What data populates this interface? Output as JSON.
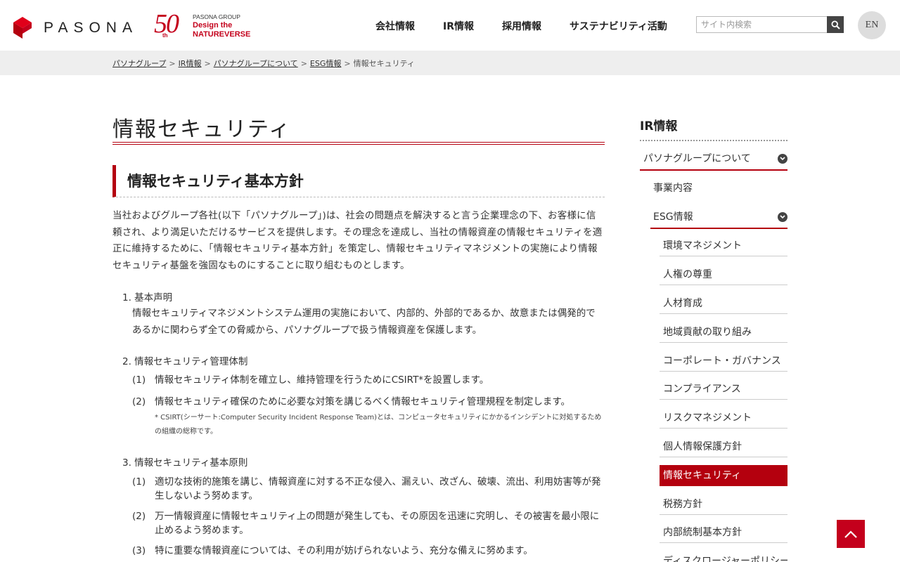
{
  "header": {
    "logo_text": "PASONA",
    "anniversary": {
      "number": "50",
      "suffix": "th",
      "group": "PASONA GROUP",
      "line1": "Design the",
      "line2": "NATUREVERSE"
    },
    "nav": [
      "会社情報",
      "IR情報",
      "採用情報",
      "サステナビリティ活動"
    ],
    "search_placeholder": "サイト内検索",
    "lang_button": "EN"
  },
  "breadcrumb": {
    "links": [
      "パソナグループ",
      "IR情報",
      "パソナグループについて",
      "ESG情報"
    ],
    "current": "情報セキュリティ",
    "separator": ">"
  },
  "main": {
    "page_title": "情報セキュリティ",
    "section_heading": "情報セキュリティ基本方針",
    "intro": "当社およびグループ各社(以下「パソナグループ」)は、社会の問題点を解決すると言う企業理念の下、お客様に信頼され、より満足いただけるサービスを提供します。その理念を達成し、当社の情報資産の情報セキュリティを適正に維持するために、「情報セキュリティ基本方針」を策定し、情報セキュリティマネジメントの実施により情報セキュリティ基盤を強固なものにすることに取り組むものとします。",
    "sections": [
      {
        "title": "1. 基本声明",
        "body": "情報セキュリティマネジメントシステム運用の実施において、内部的、外部的であるか、故意または偶発的であるかに関わらず全ての脅威から、パソナグループで扱う情報資産を保護します。"
      },
      {
        "title": "2. 情報セキュリティ管理体制",
        "items": [
          {
            "no": "(1)",
            "text": "情報セキュリティ体制を確立し、維持管理を行うためにCSIRT*を設置します。"
          },
          {
            "no": "(2)",
            "text": "情報セキュリティ確保のために必要な対策を講じるべく情報セキュリティ管理規程を制定します。"
          }
        ],
        "note": "* CSIRT(シーサート:Computer Security Incident Response Team)とは、コンピュータセキュリティにかかるインシデントに対処するための組織の総称です。"
      },
      {
        "title": "3. 情報セキュリティ基本原則",
        "items": [
          {
            "no": "(1)",
            "text": "適切な技術的施策を講じ、情報資産に対する不正な侵入、漏えい、改ざん、破壊、流出、利用妨害等が発生しないよう努めます。"
          },
          {
            "no": "(2)",
            "text": "万一情報資産に情報セキュリティ上の問題が発生しても、その原因を迅速に究明し、その被害を最小限に止めるよう努めます。"
          },
          {
            "no": "(3)",
            "text": "特に重要な情報資産については、その利用が妨げられないよう、充分な備えに努めます。"
          }
        ]
      }
    ]
  },
  "sidebar": {
    "title": "IR情報",
    "level1": "パソナグループについて",
    "level2": [
      "事業内容",
      "ESG情報"
    ],
    "level3": [
      "環境マネジメント",
      "人権の尊重",
      "人材育成",
      "地域貢献の取り組み",
      "コーポレート・ガバナンス",
      "コンプライアンス",
      "リスクマネジメント",
      "個人情報保護方針",
      "情報セキュリティ",
      "税務方針",
      "内部統制基本方針",
      "ディスクロージャーポリシー"
    ],
    "active": "情報セキュリティ"
  },
  "colors": {
    "brand_red": "#b4000e",
    "accent_red": "#c4001c"
  },
  "icons": {
    "search": "search-icon",
    "chevron": "chevron-down-icon",
    "to_top": "chevron-up-icon"
  }
}
